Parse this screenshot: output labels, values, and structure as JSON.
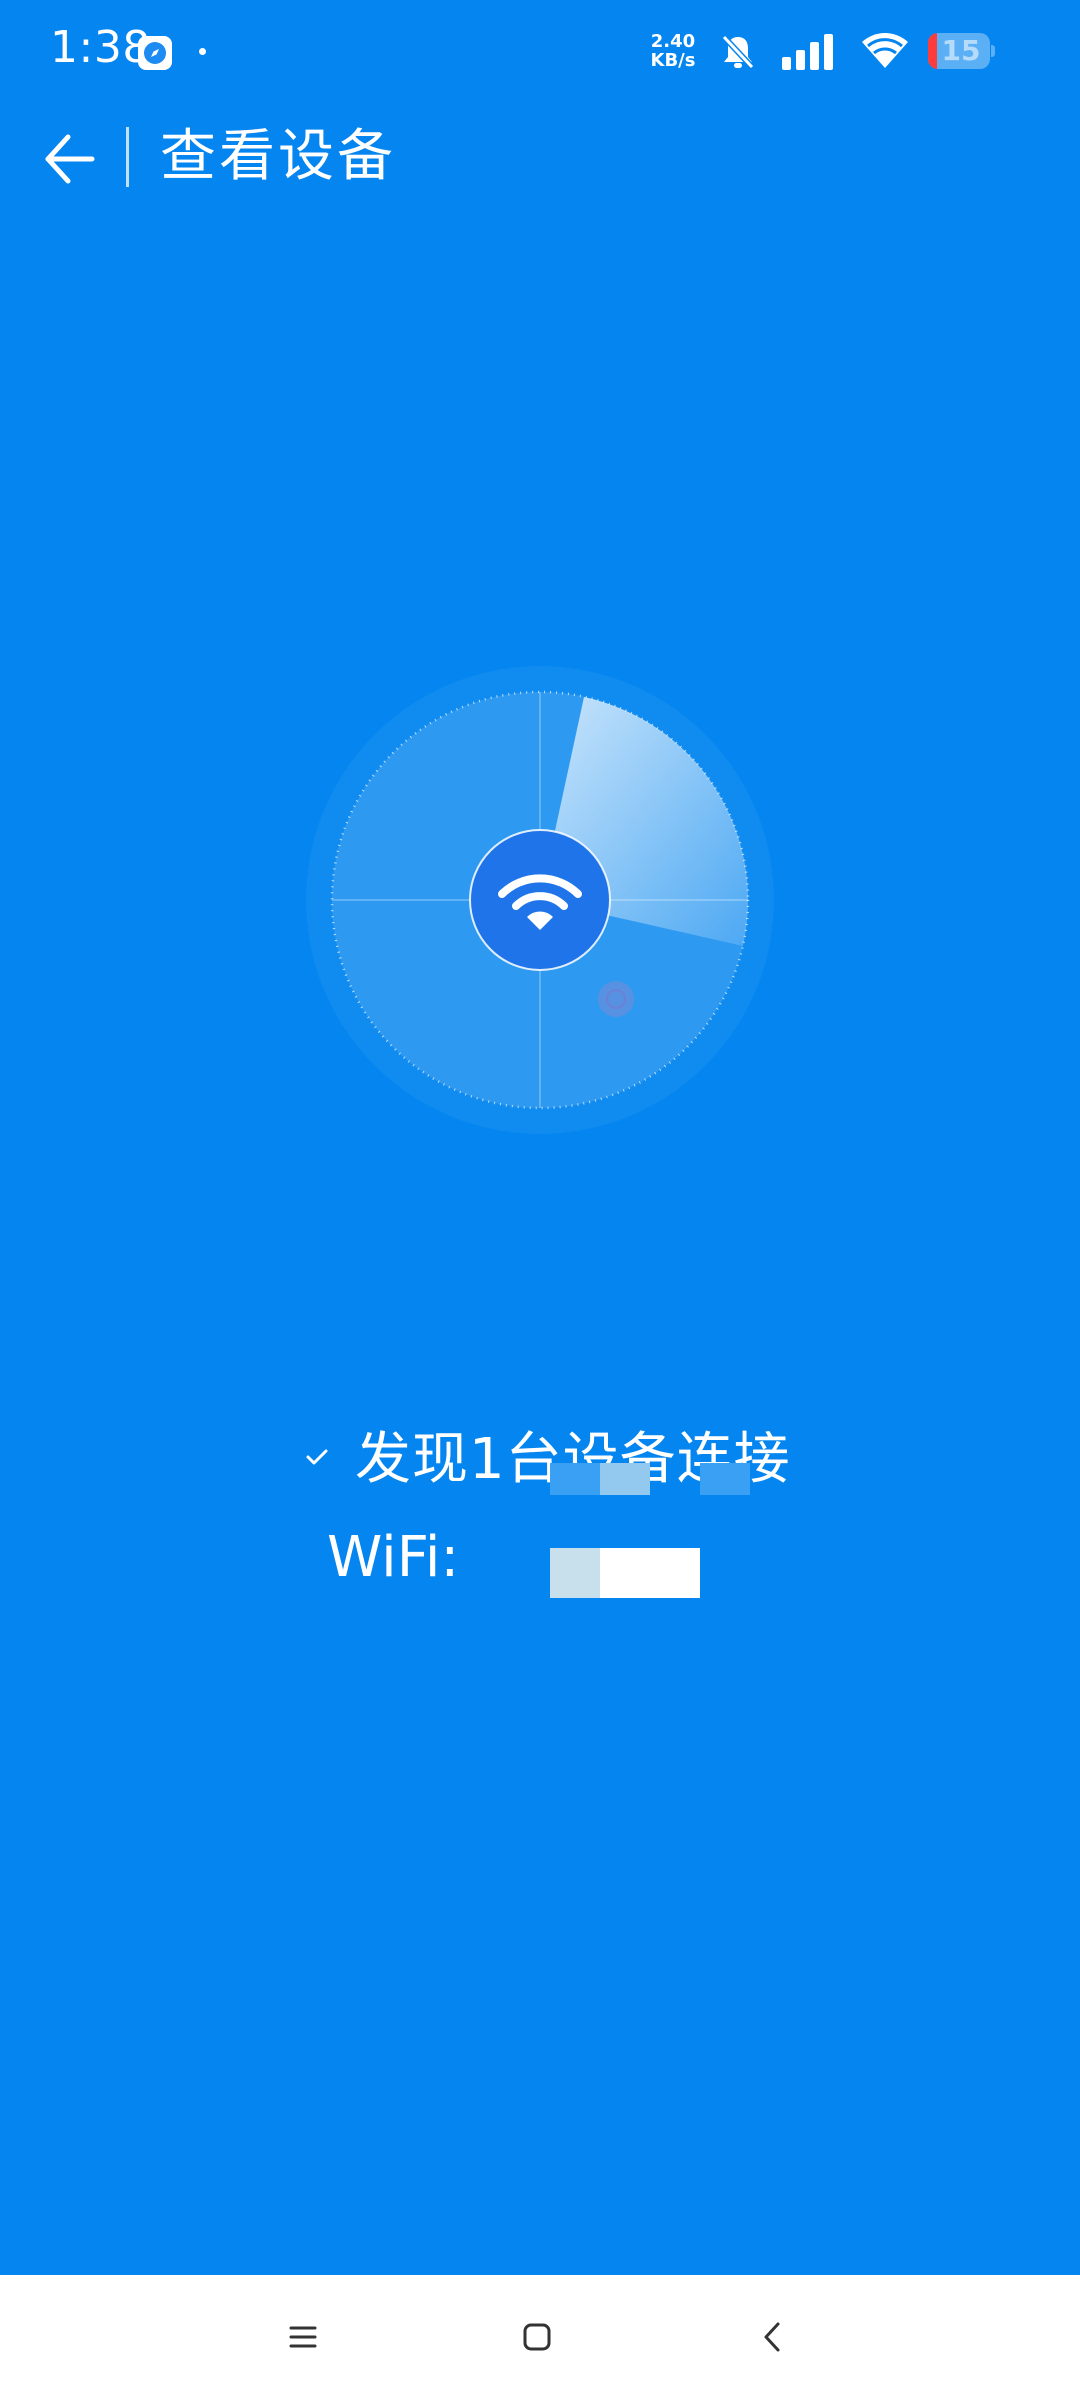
{
  "status_bar": {
    "time": "1:38",
    "net_speed_value": "2.40",
    "net_speed_unit": "KB/s",
    "battery_level": "15",
    "battery_fraction": 0.15,
    "icons": [
      "compass-app-icon",
      "dot-icon",
      "bell-off-icon",
      "signal-icon",
      "wifi-icon",
      "battery-icon"
    ]
  },
  "header": {
    "title": "查看设备",
    "back_icon": "arrow-left-icon"
  },
  "radar": {
    "center_icon": "wifi-icon"
  },
  "result": {
    "found_text": "发现1台设备连接",
    "wifi_label": "WiFi:"
  },
  "nav_bar": {
    "icons": [
      "menu-icon",
      "home-icon",
      "back-icon"
    ]
  },
  "colors": {
    "background": "#0485f0",
    "center_circle": "#1f74ea",
    "navbar": "#ffffff",
    "battery_low": "#ff3b3b"
  }
}
